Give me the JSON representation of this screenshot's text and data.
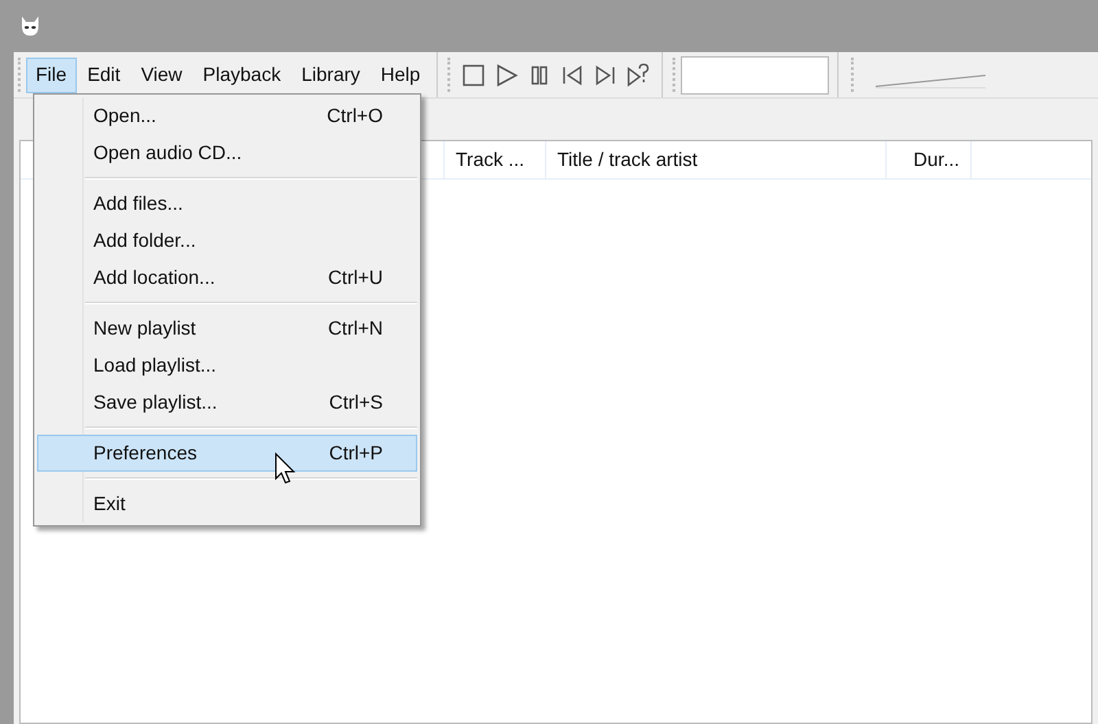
{
  "menubar": [
    {
      "label": "File",
      "selected": true
    },
    {
      "label": "Edit",
      "selected": false
    },
    {
      "label": "View",
      "selected": false
    },
    {
      "label": "Playback",
      "selected": false
    },
    {
      "label": "Library",
      "selected": false
    },
    {
      "label": "Help",
      "selected": false
    }
  ],
  "table": {
    "columns": [
      "Track ...",
      "Title / track artist",
      "Dur..."
    ]
  },
  "menu": [
    {
      "kind": "item",
      "label": "Open...",
      "shortcut": "Ctrl+O",
      "selected": false
    },
    {
      "kind": "item",
      "label": "Open audio CD...",
      "selected": false
    },
    {
      "kind": "separator"
    },
    {
      "kind": "item",
      "label": "Add files...",
      "selected": false
    },
    {
      "kind": "item",
      "label": "Add folder...",
      "selected": false
    },
    {
      "kind": "item",
      "label": "Add location...",
      "shortcut": "Ctrl+U",
      "selected": false
    },
    {
      "kind": "separator"
    },
    {
      "kind": "item",
      "label": "New playlist",
      "shortcut": "Ctrl+N",
      "selected": false
    },
    {
      "kind": "item",
      "label": "Load playlist...",
      "selected": false
    },
    {
      "kind": "item",
      "label": "Save playlist...",
      "shortcut": "Ctrl+S",
      "selected": false
    },
    {
      "kind": "separator"
    },
    {
      "kind": "item",
      "label": "Preferences",
      "shortcut": "Ctrl+P",
      "selected": true
    },
    {
      "kind": "separator"
    },
    {
      "kind": "item",
      "label": "Exit",
      "selected": false
    }
  ]
}
